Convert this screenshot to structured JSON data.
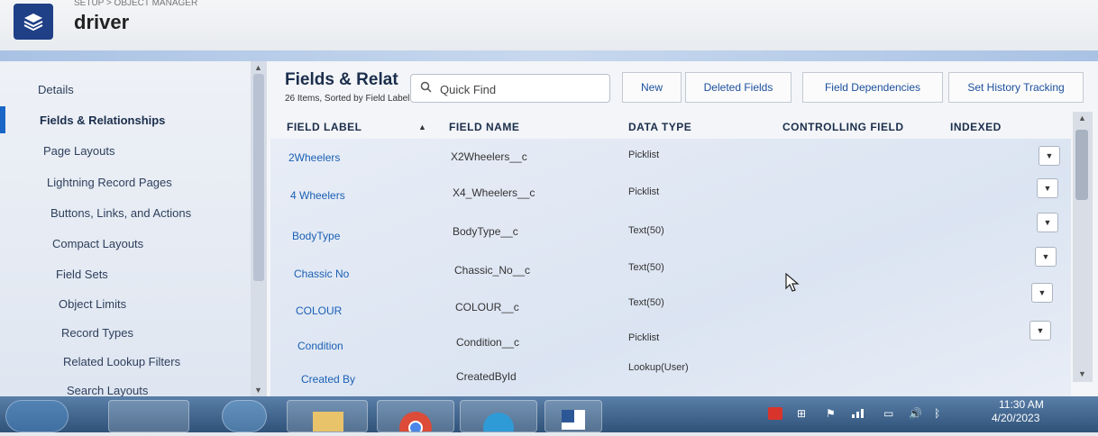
{
  "object": {
    "crumb": "SETUP > OBJECT MANAGER",
    "title": "driver"
  },
  "sidebar": {
    "items": [
      {
        "label": "Details"
      },
      {
        "label": "Fields & Relationships"
      },
      {
        "label": "Page Layouts"
      },
      {
        "label": "Lightning Record Pages"
      },
      {
        "label": "Buttons, Links, and Actions"
      },
      {
        "label": "Compact Layouts"
      },
      {
        "label": "Field Sets"
      },
      {
        "label": "Object Limits"
      },
      {
        "label": "Record Types"
      },
      {
        "label": "Related Lookup Filters"
      },
      {
        "label": "Search Layouts"
      }
    ]
  },
  "section": {
    "title": "Fields & Relat",
    "subtitle": "26 Items, Sorted by Field Label"
  },
  "search": {
    "placeholder": "Quick Find"
  },
  "toolbar": {
    "new_label": "New",
    "deleted_label": "Deleted Fields",
    "dependencies_label": "Field Dependencies",
    "history_label": "Set History Tracking"
  },
  "table": {
    "headers": {
      "label": "FIELD LABEL",
      "name": "FIELD NAME",
      "type": "DATA TYPE",
      "controlling": "CONTROLLING FIELD",
      "indexed": "INDEXED"
    },
    "rows": [
      {
        "label": "2Wheelers",
        "name": "X2Wheelers__c",
        "type": "Picklist"
      },
      {
        "label": "4 Wheelers",
        "name": "X4_Wheelers__c",
        "type": "Picklist"
      },
      {
        "label": "BodyType",
        "name": "BodyType__c",
        "type": "Text(50)"
      },
      {
        "label": "Chassic No",
        "name": "Chassic_No__c",
        "type": "Text(50)"
      },
      {
        "label": "COLOUR",
        "name": "COLOUR__c",
        "type": "Text(50)"
      },
      {
        "label": "Condition",
        "name": "Condition__c",
        "type": "Picklist"
      },
      {
        "label": "Created By",
        "name": "CreatedById",
        "type": "Lookup(User)"
      }
    ]
  },
  "taskbar": {
    "time": "11:30 AM",
    "date": "4/20/2023"
  }
}
